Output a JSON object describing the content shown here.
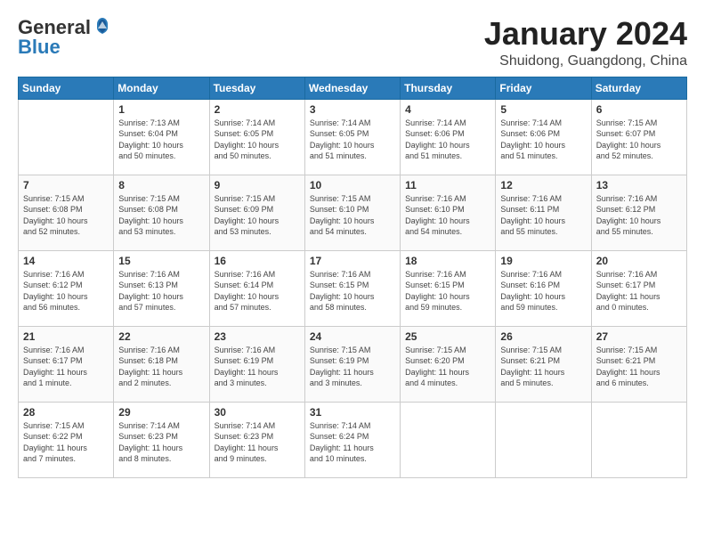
{
  "header": {
    "logo": {
      "line1": "General",
      "line2": "Blue"
    },
    "title": "January 2024",
    "subtitle": "Shuidong, Guangdong, China"
  },
  "columns": [
    "Sunday",
    "Monday",
    "Tuesday",
    "Wednesday",
    "Thursday",
    "Friday",
    "Saturday"
  ],
  "weeks": [
    [
      {
        "day": "",
        "info": ""
      },
      {
        "day": "1",
        "info": "Sunrise: 7:13 AM\nSunset: 6:04 PM\nDaylight: 10 hours\nand 50 minutes."
      },
      {
        "day": "2",
        "info": "Sunrise: 7:14 AM\nSunset: 6:05 PM\nDaylight: 10 hours\nand 50 minutes."
      },
      {
        "day": "3",
        "info": "Sunrise: 7:14 AM\nSunset: 6:05 PM\nDaylight: 10 hours\nand 51 minutes."
      },
      {
        "day": "4",
        "info": "Sunrise: 7:14 AM\nSunset: 6:06 PM\nDaylight: 10 hours\nand 51 minutes."
      },
      {
        "day": "5",
        "info": "Sunrise: 7:14 AM\nSunset: 6:06 PM\nDaylight: 10 hours\nand 51 minutes."
      },
      {
        "day": "6",
        "info": "Sunrise: 7:15 AM\nSunset: 6:07 PM\nDaylight: 10 hours\nand 52 minutes."
      }
    ],
    [
      {
        "day": "7",
        "info": "Sunrise: 7:15 AM\nSunset: 6:08 PM\nDaylight: 10 hours\nand 52 minutes."
      },
      {
        "day": "8",
        "info": "Sunrise: 7:15 AM\nSunset: 6:08 PM\nDaylight: 10 hours\nand 53 minutes."
      },
      {
        "day": "9",
        "info": "Sunrise: 7:15 AM\nSunset: 6:09 PM\nDaylight: 10 hours\nand 53 minutes."
      },
      {
        "day": "10",
        "info": "Sunrise: 7:15 AM\nSunset: 6:10 PM\nDaylight: 10 hours\nand 54 minutes."
      },
      {
        "day": "11",
        "info": "Sunrise: 7:16 AM\nSunset: 6:10 PM\nDaylight: 10 hours\nand 54 minutes."
      },
      {
        "day": "12",
        "info": "Sunrise: 7:16 AM\nSunset: 6:11 PM\nDaylight: 10 hours\nand 55 minutes."
      },
      {
        "day": "13",
        "info": "Sunrise: 7:16 AM\nSunset: 6:12 PM\nDaylight: 10 hours\nand 55 minutes."
      }
    ],
    [
      {
        "day": "14",
        "info": "Sunrise: 7:16 AM\nSunset: 6:12 PM\nDaylight: 10 hours\nand 56 minutes."
      },
      {
        "day": "15",
        "info": "Sunrise: 7:16 AM\nSunset: 6:13 PM\nDaylight: 10 hours\nand 57 minutes."
      },
      {
        "day": "16",
        "info": "Sunrise: 7:16 AM\nSunset: 6:14 PM\nDaylight: 10 hours\nand 57 minutes."
      },
      {
        "day": "17",
        "info": "Sunrise: 7:16 AM\nSunset: 6:15 PM\nDaylight: 10 hours\nand 58 minutes."
      },
      {
        "day": "18",
        "info": "Sunrise: 7:16 AM\nSunset: 6:15 PM\nDaylight: 10 hours\nand 59 minutes."
      },
      {
        "day": "19",
        "info": "Sunrise: 7:16 AM\nSunset: 6:16 PM\nDaylight: 10 hours\nand 59 minutes."
      },
      {
        "day": "20",
        "info": "Sunrise: 7:16 AM\nSunset: 6:17 PM\nDaylight: 11 hours\nand 0 minutes."
      }
    ],
    [
      {
        "day": "21",
        "info": "Sunrise: 7:16 AM\nSunset: 6:17 PM\nDaylight: 11 hours\nand 1 minute."
      },
      {
        "day": "22",
        "info": "Sunrise: 7:16 AM\nSunset: 6:18 PM\nDaylight: 11 hours\nand 2 minutes."
      },
      {
        "day": "23",
        "info": "Sunrise: 7:16 AM\nSunset: 6:19 PM\nDaylight: 11 hours\nand 3 minutes."
      },
      {
        "day": "24",
        "info": "Sunrise: 7:15 AM\nSunset: 6:19 PM\nDaylight: 11 hours\nand 3 minutes."
      },
      {
        "day": "25",
        "info": "Sunrise: 7:15 AM\nSunset: 6:20 PM\nDaylight: 11 hours\nand 4 minutes."
      },
      {
        "day": "26",
        "info": "Sunrise: 7:15 AM\nSunset: 6:21 PM\nDaylight: 11 hours\nand 5 minutes."
      },
      {
        "day": "27",
        "info": "Sunrise: 7:15 AM\nSunset: 6:21 PM\nDaylight: 11 hours\nand 6 minutes."
      }
    ],
    [
      {
        "day": "28",
        "info": "Sunrise: 7:15 AM\nSunset: 6:22 PM\nDaylight: 11 hours\nand 7 minutes."
      },
      {
        "day": "29",
        "info": "Sunrise: 7:14 AM\nSunset: 6:23 PM\nDaylight: 11 hours\nand 8 minutes."
      },
      {
        "day": "30",
        "info": "Sunrise: 7:14 AM\nSunset: 6:23 PM\nDaylight: 11 hours\nand 9 minutes."
      },
      {
        "day": "31",
        "info": "Sunrise: 7:14 AM\nSunset: 6:24 PM\nDaylight: 11 hours\nand 10 minutes."
      },
      {
        "day": "",
        "info": ""
      },
      {
        "day": "",
        "info": ""
      },
      {
        "day": "",
        "info": ""
      }
    ]
  ]
}
